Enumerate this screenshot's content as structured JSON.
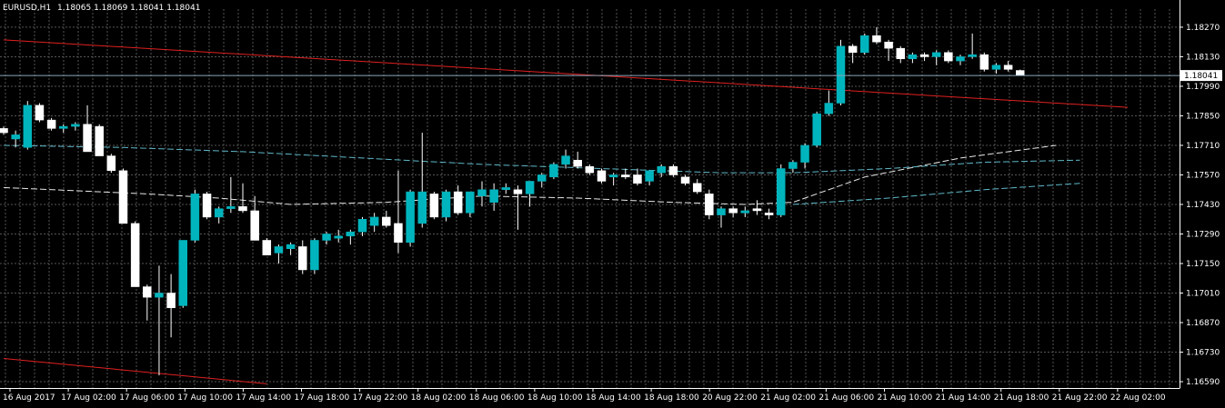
{
  "header": {
    "symbol": "EURUSD,H1",
    "ohlc": "1.18065 1.18069 1.18041 1.18041"
  },
  "colors": {
    "background": "#000000",
    "grid": "#555555",
    "bull": "#00b4bd",
    "bear": "#ffffff",
    "trend": "#e02020",
    "ma_white": "#e8e8e8",
    "ma_cyan": "#5fb9c9",
    "price_line": "#8aa6b8"
  },
  "chart_data": {
    "type": "candlestick",
    "y_ticks": [
      1.1827,
      1.1813,
      1.1799,
      1.1785,
      1.1771,
      1.1757,
      1.1743,
      1.1729,
      1.1715,
      1.1701,
      1.1687,
      1.1673,
      1.1659
    ],
    "y_tick_labels": [
      "1.18270",
      "1.18130",
      "1.17990",
      "1.17850",
      "1.17710",
      "1.17570",
      "1.17430",
      "1.17290",
      "1.17150",
      "1.17010",
      "1.16870",
      "1.16730",
      "1.16590"
    ],
    "ylim": [
      1.1656,
      1.1833
    ],
    "x_labels": [
      "16 Aug 2017",
      "17 Aug 02:00",
      "17 Aug 06:00",
      "17 Aug 10:00",
      "17 Aug 14:00",
      "17 Aug 18:00",
      "17 Aug 22:00",
      "18 Aug 02:00",
      "18 Aug 06:00",
      "18 Aug 10:00",
      "18 Aug 14:00",
      "18 Aug 18:00",
      "20 Aug 22:00",
      "21 Aug 02:00",
      "21 Aug 06:00",
      "21 Aug 10:00",
      "21 Aug 14:00",
      "21 Aug 18:00",
      "21 Aug 22:00",
      "22 Aug 02:00"
    ],
    "last_price": 1.18041,
    "last_price_label": "1.18041",
    "candles": [
      [
        1.1779,
        1.178,
        1.1776,
        1.1777
      ],
      [
        1.1774,
        1.1778,
        1.177,
        1.1776
      ],
      [
        1.177,
        1.1792,
        1.1769,
        1.179
      ],
      [
        1.179,
        1.1791,
        1.1782,
        1.1783
      ],
      [
        1.1783,
        1.1784,
        1.1778,
        1.1779
      ],
      [
        1.1779,
        1.1781,
        1.1777,
        1.178
      ],
      [
        1.178,
        1.1782,
        1.1778,
        1.1781
      ],
      [
        1.1781,
        1.179,
        1.177,
        1.1768
      ],
      [
        1.178,
        1.1781,
        1.1766,
        1.1766
      ],
      [
        1.1766,
        1.1767,
        1.1758,
        1.1759
      ],
      [
        1.1759,
        1.176,
        1.1734,
        1.1734
      ],
      [
        1.1734,
        1.1735,
        1.1704,
        1.1704
      ],
      [
        1.1704,
        1.1705,
        1.1688,
        1.1699
      ],
      [
        1.1699,
        1.1714,
        1.1662,
        1.1701
      ],
      [
        1.1701,
        1.171,
        1.168,
        1.1694
      ],
      [
        1.1695,
        1.1726,
        1.1694,
        1.1726
      ],
      [
        1.1726,
        1.175,
        1.1725,
        1.1748
      ],
      [
        1.1748,
        1.1749,
        1.1736,
        1.1737
      ],
      [
        1.1737,
        1.1742,
        1.1734,
        1.1741
      ],
      [
        1.1741,
        1.1756,
        1.1739,
        1.1742
      ],
      [
        1.1742,
        1.1753,
        1.1739,
        1.174
      ],
      [
        1.174,
        1.1747,
        1.1726,
        1.1726
      ],
      [
        1.1726,
        1.1727,
        1.1719,
        1.1719
      ],
      [
        1.172,
        1.1724,
        1.1715,
        1.1723
      ],
      [
        1.1722,
        1.1725,
        1.1719,
        1.1724
      ],
      [
        1.1723,
        1.1726,
        1.171,
        1.1712
      ],
      [
        1.1712,
        1.1727,
        1.171,
        1.1726
      ],
      [
        1.1726,
        1.173,
        1.1724,
        1.1729
      ],
      [
        1.1727,
        1.1731,
        1.1725,
        1.1728
      ],
      [
        1.1728,
        1.1731,
        1.1724,
        1.173
      ],
      [
        1.173,
        1.1737,
        1.1728,
        1.1736
      ],
      [
        1.1733,
        1.1739,
        1.173,
        1.1737
      ],
      [
        1.1737,
        1.174,
        1.1732,
        1.1733
      ],
      [
        1.1734,
        1.1759,
        1.172,
        1.1725
      ],
      [
        1.1725,
        1.175,
        1.1723,
        1.1749
      ],
      [
        1.1734,
        1.1777,
        1.1732,
        1.1749
      ],
      [
        1.1748,
        1.1749,
        1.1736,
        1.1737
      ],
      [
        1.1737,
        1.175,
        1.1735,
        1.1749
      ],
      [
        1.1749,
        1.1752,
        1.1738,
        1.1739
      ],
      [
        1.1739,
        1.1747,
        1.1737,
        1.1749
      ],
      [
        1.1747,
        1.1754,
        1.1742,
        1.175
      ],
      [
        1.1744,
        1.1753,
        1.174,
        1.175
      ],
      [
        1.175,
        1.1753,
        1.1748,
        1.1751
      ],
      [
        1.175,
        1.1752,
        1.1731,
        1.1748
      ],
      [
        1.1748,
        1.1752,
        1.1742,
        1.1754
      ],
      [
        1.1754,
        1.1758,
        1.1751,
        1.1757
      ],
      [
        1.1756,
        1.1763,
        1.1755,
        1.1762
      ],
      [
        1.1762,
        1.1769,
        1.176,
        1.1766
      ],
      [
        1.1764,
        1.1768,
        1.176,
        1.1761
      ],
      [
        1.1761,
        1.1762,
        1.1757,
        1.1758
      ],
      [
        1.1759,
        1.176,
        1.1753,
        1.1754
      ],
      [
        1.1756,
        1.1758,
        1.1752,
        1.1757
      ],
      [
        1.1757,
        1.176,
        1.1755,
        1.1756
      ],
      [
        1.1757,
        1.176,
        1.1752,
        1.1753
      ],
      [
        1.1754,
        1.1758,
        1.1752,
        1.1759
      ],
      [
        1.1758,
        1.1762,
        1.1756,
        1.1761
      ],
      [
        1.1761,
        1.1762,
        1.1756,
        1.1757
      ],
      [
        1.1756,
        1.1757,
        1.1752,
        1.1753
      ],
      [
        1.1753,
        1.1755,
        1.1748,
        1.1749
      ],
      [
        1.1748,
        1.175,
        1.1736,
        1.1738
      ],
      [
        1.1738,
        1.1742,
        1.1732,
        1.1741
      ],
      [
        1.1741,
        1.1742,
        1.1737,
        1.1739
      ],
      [
        1.1739,
        1.1742,
        1.1737,
        1.174
      ],
      [
        1.1741,
        1.1745,
        1.1738,
        1.174
      ],
      [
        1.1739,
        1.1741,
        1.1736,
        1.1738
      ],
      [
        1.1738,
        1.1762,
        1.1737,
        1.176
      ],
      [
        1.176,
        1.1764,
        1.1758,
        1.1763
      ],
      [
        1.1763,
        1.1772,
        1.176,
        1.1771
      ],
      [
        1.1771,
        1.1787,
        1.177,
        1.1786
      ],
      [
        1.1786,
        1.1797,
        1.1785,
        1.1791
      ],
      [
        1.1791,
        1.1821,
        1.179,
        1.1818
      ],
      [
        1.1818,
        1.1819,
        1.181,
        1.1815
      ],
      [
        1.1815,
        1.1824,
        1.1814,
        1.1823
      ],
      [
        1.1823,
        1.1827,
        1.1819,
        1.182
      ],
      [
        1.182,
        1.1821,
        1.1811,
        1.1817
      ],
      [
        1.1817,
        1.1818,
        1.181,
        1.1812
      ],
      [
        1.1812,
        1.1815,
        1.181,
        1.1814
      ],
      [
        1.1814,
        1.1815,
        1.1811,
        1.1813
      ],
      [
        1.1813,
        1.1816,
        1.1809,
        1.1815
      ],
      [
        1.1815,
        1.1816,
        1.181,
        1.1811
      ],
      [
        1.1811,
        1.1814,
        1.1809,
        1.1813
      ],
      [
        1.1813,
        1.1824,
        1.1812,
        1.1814
      ],
      [
        1.1814,
        1.1815,
        1.1806,
        1.1807
      ],
      [
        1.1807,
        1.181,
        1.1805,
        1.1809
      ],
      [
        1.1809,
        1.1811,
        1.1806,
        1.1807
      ],
      [
        1.18065,
        1.18069,
        1.18041,
        1.18041
      ]
    ],
    "trend_lines": [
      {
        "color": "red",
        "points": [
          [
            0,
            1.1821
          ],
          [
            94,
            1.1789
          ]
        ]
      },
      {
        "color": "red",
        "points": [
          [
            0,
            1.167
          ],
          [
            22,
            1.1658
          ]
        ]
      }
    ],
    "moving_averages": [
      {
        "color": "white",
        "style": "dashed",
        "points": [
          [
            0,
            1.1751
          ],
          [
            12,
            1.1748
          ],
          [
            18,
            1.1746
          ],
          [
            24,
            1.1743
          ],
          [
            32,
            1.1744
          ],
          [
            40,
            1.1747
          ],
          [
            48,
            1.1746
          ],
          [
            56,
            1.1744
          ],
          [
            62,
            1.1743
          ],
          [
            66,
            1.1744
          ],
          [
            72,
            1.1756
          ],
          [
            80,
            1.1765
          ],
          [
            88,
            1.1771
          ]
        ]
      },
      {
        "color": "cyan",
        "style": "dashed",
        "points": [
          [
            0,
            1.1771
          ],
          [
            10,
            1.177
          ],
          [
            20,
            1.1768
          ],
          [
            30,
            1.1765
          ],
          [
            40,
            1.1762
          ],
          [
            50,
            1.176
          ],
          [
            60,
            1.1758
          ],
          [
            66,
            1.1758
          ],
          [
            74,
            1.176
          ],
          [
            82,
            1.1763
          ],
          [
            90,
            1.1764
          ]
        ]
      },
      {
        "color": "cyan",
        "style": "dashed",
        "points": [
          [
            66,
            1.1743
          ],
          [
            74,
            1.1746
          ],
          [
            82,
            1.175
          ],
          [
            90,
            1.1753
          ]
        ]
      }
    ]
  }
}
